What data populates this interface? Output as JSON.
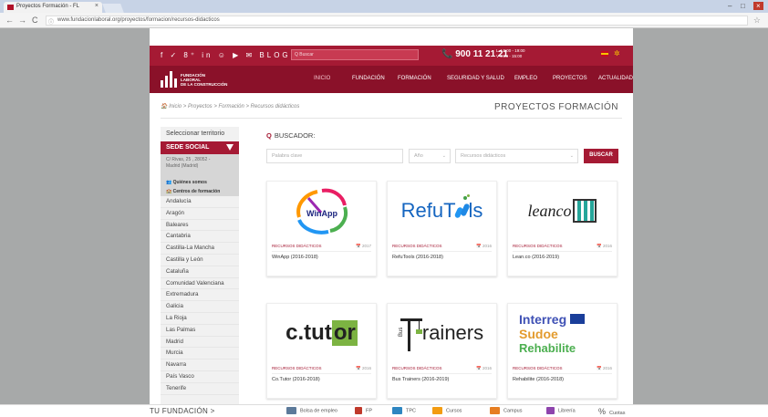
{
  "browser": {
    "tab_title": "Proyectos Formación - FL",
    "tab_close": "×",
    "url": "www.fundacionlaboral.org/proyectos/formacion/recursos-didacticos",
    "back": "←",
    "forward": "→",
    "reload": "C",
    "info": "ⓘ",
    "star": "☆",
    "minimize": "–",
    "maximize": "□",
    "close": "×"
  },
  "topbar": {
    "social": "f ✓ 8⁺ in ☺ ▶ ✉ BLOG",
    "search_placeholder": "Q Buscar",
    "phone": "📞 900 11 21 21",
    "hours_line1": "L-J 9:00 - 19:00",
    "hours_line2": "V 9:00 - 15:00",
    "lang": "✲"
  },
  "logo": {
    "line1": "FUNDACIÓN",
    "line2": "LABORAL",
    "line3": "DE LA CONSTRUCCIÓN"
  },
  "menu": {
    "inicio": "INICIO",
    "fundacion": "FUNDACIÓN",
    "formacion": "FORMACIÓN",
    "seguridad": "SEGURIDAD Y SALUD",
    "empleo": "EMPLEO",
    "proyectos": "PROYECTOS",
    "actualidad": "ACTUALIDAD"
  },
  "breadcrumb": "🏠 Inicio > Proyectos > Formación > Recursos didácticos",
  "page_title": "PROYECTOS FORMACIÓN",
  "sidebar": {
    "heading": "Seleccionar territorio",
    "sede": "SEDE SOCIAL",
    "address_line1": "C/ Rivas, 25 , 28052 -",
    "address_line2": "Madrid (Madrid)",
    "link1": "👥 Quiénes somos",
    "link2": "🏫 Centros de formación",
    "regions": [
      "Andalucía",
      "Aragón",
      "Baleares",
      "Cantabria",
      "Castilla-La Mancha",
      "Castilla y León",
      "Cataluña",
      "Comunidad Valenciana",
      "Extremadura",
      "Galicia",
      "La Rioja",
      "Las Palmas",
      "Madrid",
      "Murcia",
      "Navarra",
      "País Vasco",
      "Tenerife"
    ]
  },
  "search": {
    "title": "BUSCADOR:",
    "keyword_placeholder": "Palabra clave",
    "year_placeholder": "Año",
    "type_placeholder": "Recursos didácticos",
    "button": "BUSCAR"
  },
  "cards": [
    {
      "category": "RECURSOS DIDÁCTICOS",
      "year": "📅 2017",
      "name": "WinApp (2016-2018)",
      "logo": "WinApp"
    },
    {
      "category": "RECURSOS DIDÁCTICOS",
      "year": "📅 2016",
      "name": "RefuTools (2016-2018)",
      "logo_a": "RefuT",
      "logo_b": "ls"
    },
    {
      "category": "RECURSOS DIDÁCTICOS",
      "year": "📅 2016",
      "name": "Lean.co (2016-2019)",
      "logo": "leanco"
    },
    {
      "category": "RECURSOS DIDÁCTICOS",
      "year": "📅 2016",
      "name": "Co.Tutor (2016-2018)",
      "logo_a": "c",
      "logo_b": ".tut",
      "logo_c": "or"
    },
    {
      "category": "RECURSOS DIDÁCTICOS",
      "year": "📅 2016",
      "name": "Bus Trainers (2016-2019)",
      "logo_a": "Bus",
      "logo_b": "rainers"
    },
    {
      "category": "RECURSOS DIDÁCTICOS",
      "year": "📅 2016",
      "name": "Rehabilite (2016-2018)",
      "logo_a": "Interreg",
      "logo_b": "Sudoe",
      "logo_c": "Rehabilite"
    }
  ],
  "footer": {
    "tu_fundacion": "TU FUNDACIÓN >",
    "items": [
      "Bolsa de empleo",
      "FP",
      "TPC",
      "Cursos",
      "Campus",
      "Librería",
      "Cuotas"
    ]
  }
}
